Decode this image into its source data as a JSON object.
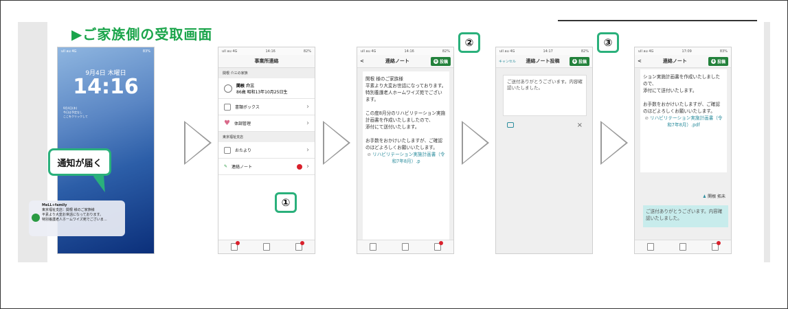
{
  "title": "▶ご家族側の受取画面",
  "callout_notification": "通知が届く",
  "numbers": [
    "①",
    "②",
    "③"
  ],
  "phone1": {
    "date": "9月4日 木曜日",
    "time": "14:16",
    "widget": [
      "9月4日(木)",
      "今日は予定なし",
      "ここをクリックして"
    ],
    "notif_app": "MeLL+family",
    "notif_line1": "東京福祉支店：関根 様のご家族様",
    "notif_line2": "平素より大変お世話になっております。",
    "notif_line3": "特別養護老人ホームワイズ苑でございま…",
    "status_left": "ull au 4G",
    "status_right": "83%"
  },
  "phone2": {
    "status": [
      "ull au 4G",
      "14:16",
      "82%"
    ],
    "nav_title": "事業所連絡",
    "section1": "関根 介三の家族",
    "person_name": "関根 介三",
    "person_detail": "86歳 昭和13年10月25日生",
    "row1": "書類ボックス",
    "row2": "体調管理",
    "section2": "東京福祉支店",
    "row3": "おたより",
    "row4": "連絡ノート"
  },
  "phone3": {
    "status": [
      "ull au 4G",
      "14:16",
      "82%"
    ],
    "nav_title": "連絡ノート",
    "post": "投稿",
    "back": "<",
    "lines": [
      "関根 様のご家族様",
      "",
      "平素より大変お世話になっております。",
      "特別養護老人ホームワイズ苑でございます。",
      "",
      "この度8月分のリハビリテーション実施計画書を作成いたしましたので、",
      "添付にて送付いたします。",
      "",
      "お手数をおかけいたしますが、ご確認のほどよろしくお願いいたします。"
    ],
    "link": "リハビリテーション実施計画書（令和7年8月）.p"
  },
  "phone4": {
    "status": [
      "ull au 4G",
      "14:17",
      "82%"
    ],
    "cancel": "キャンセル",
    "nav_title": "連絡ノート投稿",
    "post": "投稿",
    "draft": "ご送付ありがとうございます。内容確認いたしました。",
    "close": "×"
  },
  "phone5": {
    "status": [
      "ull au 4G",
      "17:09",
      "83%"
    ],
    "nav_title": "連絡ノート",
    "post": "投稿",
    "back": "<",
    "lines": [
      "ション実施計画書を作成いたしましたので、",
      "添付にて送付いたします。",
      "",
      "お手数をおかけいたしますが、ご確認のほどよろしくお願いいたします。"
    ],
    "link": "リハビリテーション実施計画書（令和7年8月）.pdf",
    "sender": "関根 拓未",
    "reply": "ご送付ありがとうございます。内容確認いたしました。"
  },
  "colors": {
    "accent": "#1aa44a",
    "callout": "#2ab07b",
    "badge": "#d9202b",
    "post_btn": "#22813b"
  }
}
